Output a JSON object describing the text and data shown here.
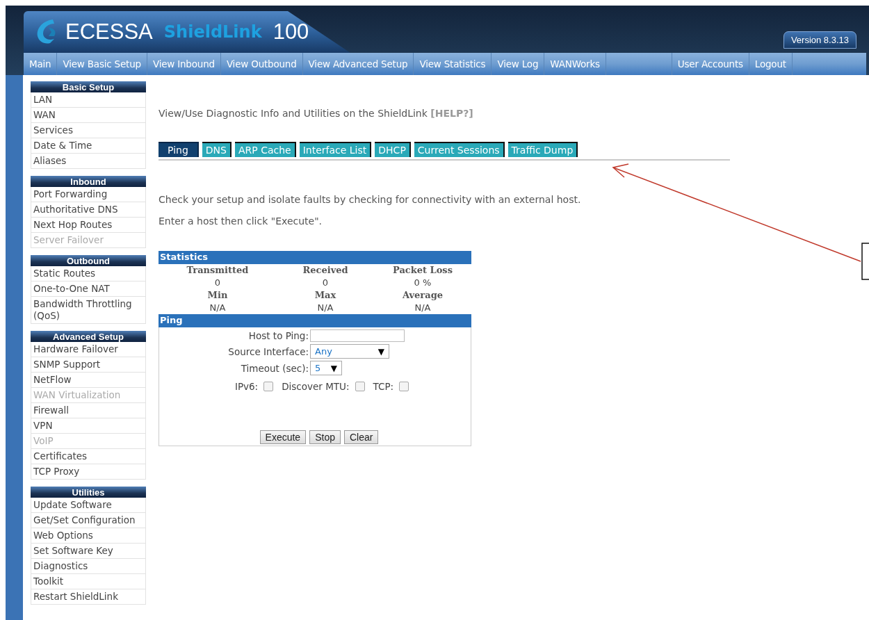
{
  "header": {
    "brand": "ECESSA",
    "product": "ShieldLink",
    "model": "100",
    "version": "Version 8.3.13"
  },
  "nav": {
    "left": [
      "Main",
      "View Basic Setup",
      "View Inbound",
      "View Outbound",
      "View Advanced Setup",
      "View Statistics",
      "View Log",
      "WANWorks"
    ],
    "right": [
      "User Accounts",
      "Logout"
    ]
  },
  "sidebar": [
    {
      "title": "Basic Setup",
      "items": [
        {
          "label": "LAN",
          "disabled": false
        },
        {
          "label": "WAN",
          "disabled": false
        },
        {
          "label": "Services",
          "disabled": false
        },
        {
          "label": "Date & Time",
          "disabled": false
        },
        {
          "label": "Aliases",
          "disabled": false
        }
      ]
    },
    {
      "title": "Inbound",
      "items": [
        {
          "label": "Port Forwarding",
          "disabled": false
        },
        {
          "label": "Authoritative DNS",
          "disabled": false
        },
        {
          "label": "Next Hop Routes",
          "disabled": false
        },
        {
          "label": "Server Failover",
          "disabled": true
        }
      ]
    },
    {
      "title": "Outbound",
      "items": [
        {
          "label": "Static Routes",
          "disabled": false
        },
        {
          "label": "One-to-One NAT",
          "disabled": false
        },
        {
          "label": "Bandwidth Throttling (QoS)",
          "disabled": false
        }
      ]
    },
    {
      "title": "Advanced Setup",
      "items": [
        {
          "label": "Hardware Failover",
          "disabled": false
        },
        {
          "label": "SNMP Support",
          "disabled": false
        },
        {
          "label": "NetFlow",
          "disabled": false
        },
        {
          "label": "WAN Virtualization",
          "disabled": true
        },
        {
          "label": "Firewall",
          "disabled": false
        },
        {
          "label": "VPN",
          "disabled": false
        },
        {
          "label": "VoIP",
          "disabled": true
        },
        {
          "label": "Certificates",
          "disabled": false
        },
        {
          "label": "TCP Proxy",
          "disabled": false
        }
      ]
    },
    {
      "title": "Utilities",
      "items": [
        {
          "label": "Update Software",
          "disabled": false
        },
        {
          "label": "Get/Set Configuration",
          "disabled": false
        },
        {
          "label": "Web Options",
          "disabled": false
        },
        {
          "label": "Set Software Key",
          "disabled": false
        },
        {
          "label": "Diagnostics",
          "disabled": false
        },
        {
          "label": "Toolkit",
          "disabled": false
        },
        {
          "label": "Restart ShieldLink",
          "disabled": false
        }
      ]
    }
  ],
  "page_title": {
    "text": "View/Use Diagnostic Info and Utilities on the ShieldLink",
    "help": "[HELP?]"
  },
  "tabs": [
    {
      "label": "Ping",
      "selected": true
    },
    {
      "label": "DNS",
      "selected": false
    },
    {
      "label": "ARP Cache",
      "selected": false
    },
    {
      "label": "Interface List",
      "selected": false
    },
    {
      "label": "DHCP",
      "selected": false
    },
    {
      "label": "Current Sessions",
      "selected": false
    },
    {
      "label": "Traffic Dump",
      "selected": false
    }
  ],
  "intro": [
    "Check your setup and isolate faults by checking for connectivity with an external host.",
    "Enter a host then click \"Execute\"."
  ],
  "statistics": {
    "title": "Statistics",
    "rows": [
      [
        {
          "label": "Transmitted",
          "value": "0"
        },
        {
          "label": "Received",
          "value": "0"
        },
        {
          "label": "Packet Loss",
          "value": "0 %"
        }
      ],
      [
        {
          "label": "Min",
          "value": "N/A"
        },
        {
          "label": "Max",
          "value": "N/A"
        },
        {
          "label": "Average",
          "value": "N/A"
        }
      ]
    ]
  },
  "ping": {
    "title": "Ping",
    "host_label": "Host to Ping:",
    "source_label": "Source Interface:",
    "source_value": "Any",
    "timeout_label": "Timeout (sec):",
    "timeout_value": "5",
    "select_caret": "▼",
    "options": [
      {
        "label": "IPv6:",
        "checked": false
      },
      {
        "label": "Discover MTU:",
        "checked": false
      },
      {
        "label": "TCP:",
        "checked": false
      }
    ],
    "buttons": [
      "Execute",
      "Stop",
      "Clear"
    ]
  }
}
